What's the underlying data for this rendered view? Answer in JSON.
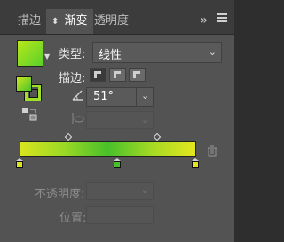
{
  "tabs": [
    {
      "label": "描边"
    },
    {
      "label": "渐变"
    },
    {
      "label": "透明度"
    }
  ],
  "gradient_type": {
    "label": "类型:",
    "value": "线性"
  },
  "stroke": {
    "label": "描边:"
  },
  "angle": {
    "value": "51°"
  },
  "opacity": {
    "label": "不透明度:"
  },
  "location": {
    "label": "位置:"
  },
  "colors": {
    "stop_left": "#d8e41e",
    "stop_middle": "#48c02a",
    "stop_right": "#e4e51e"
  }
}
